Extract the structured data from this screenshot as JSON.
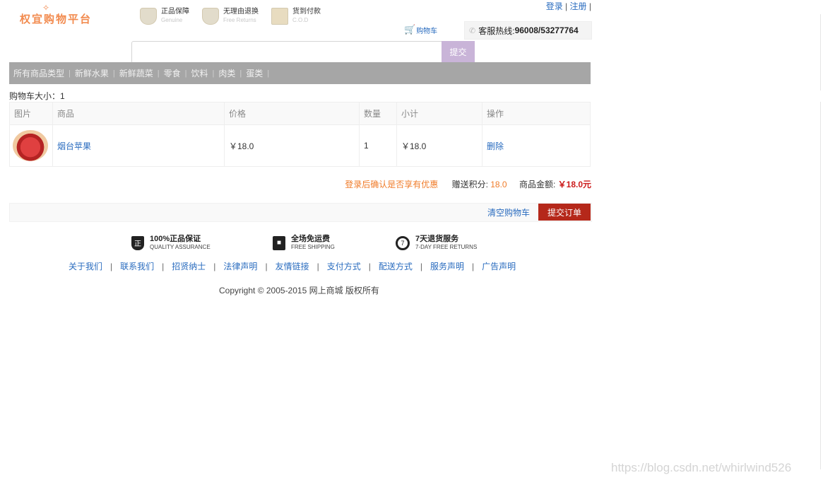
{
  "header": {
    "logo_text": "权宜购物平台",
    "badges": [
      {
        "title": "正品保障",
        "sub": "Genuine"
      },
      {
        "title": "无理由退换",
        "sub": "Free Returns"
      },
      {
        "title": "货到付款",
        "sub": "C.O.D"
      }
    ],
    "login": "登录",
    "register": "注册",
    "sep": "|",
    "cart_link": "购物车",
    "hotline_label": "客服热线:",
    "hotline_number": "96008/53277764"
  },
  "search": {
    "value": "",
    "placeholder": "",
    "button": "提交"
  },
  "nav": {
    "items": [
      "所有商品类型",
      "新鲜水果",
      "新鲜蔬菜",
      "零食",
      "饮料",
      "肉类",
      "蛋类"
    ],
    "sep": "|"
  },
  "cart": {
    "size_label": "购物车大小：1",
    "columns": [
      "图片",
      "商品",
      "价格",
      "数量",
      "小计",
      "操作"
    ],
    "rows": [
      {
        "product": "烟台苹果",
        "price": "￥18.0",
        "qty": "1",
        "subtotal": "￥18.0",
        "action": "删除"
      }
    ],
    "login_note": "登录后确认是否享有优惠",
    "points_label": "赠送积分:",
    "points_value": "18.0",
    "amount_label": "商品金额:",
    "amount_value": "￥18.0元",
    "clear_button": "清空购物车",
    "submit_button": "提交订单"
  },
  "footer": {
    "promises": [
      {
        "title": "100%正品保证",
        "sub": "QUALITY ASSURANCE",
        "icon": "genuine-icon",
        "glyph": "正"
      },
      {
        "title": "全场免运费",
        "sub": "FREE SHIPPING",
        "icon": "box-icon",
        "glyph": "■"
      },
      {
        "title": "7天退货服务",
        "sub": "7-DAY FREE RETURNS",
        "icon": "clock-icon",
        "glyph": "7"
      }
    ],
    "links": [
      "关于我们",
      "联系我们",
      "招贤纳士",
      "法律声明",
      "友情链接",
      "支付方式",
      "配送方式",
      "服务声明",
      "广告声明"
    ],
    "link_sep": "|",
    "copyright": "Copyright © 2005-2015 网上商城 版权所有"
  },
  "watermark": "https://blog.csdn.net/whirlwind526",
  "colors": {
    "link": "#2a6cbf",
    "nav_bg": "#a6a6a6",
    "search_btn": "#c9b4d8",
    "submit_btn": "#b5281a",
    "price_red": "#cc1b1b",
    "orange": "#f07c2a"
  }
}
